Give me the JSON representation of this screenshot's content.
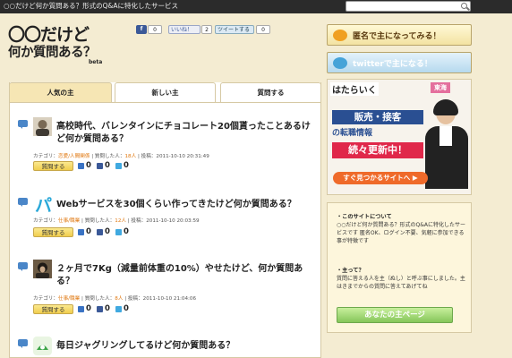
{
  "topbar": {
    "tagline": "○○だけど何か質問ある？形式のQ&Aに特化したサービス",
    "search_placeholder": ""
  },
  "logo": {
    "line1": "〇〇だけど",
    "line2": "何か質問ある？",
    "beta": "beta"
  },
  "social": {
    "facebook_share": "f",
    "facebook_count": "0",
    "like_label": "いいね！",
    "like_count": "2",
    "tweet_label": "ツイートする",
    "tweet_count": "0"
  },
  "tabs": [
    {
      "label": "人気の主"
    },
    {
      "label": "新しい主"
    },
    {
      "label": "質問する"
    }
  ],
  "questions": [
    {
      "title": "高校時代、バレンタインにチョコレート20個貰ったことあるけど何か質問ある？",
      "meta_prefix": "カテゴリ：",
      "category": "恋愛/人間関係",
      "meta_mid": " | 質問した人：",
      "askers": "18人",
      "meta_suffix": " | 投稿：2011-10-10 20:31:49",
      "ask_label": "質問する",
      "counts": [
        "0",
        "0",
        "0"
      ]
    },
    {
      "title": "Webサービスを30個くらい作ってきたけど何か質問ある？",
      "meta_prefix": "カテゴリ：",
      "category": "仕事/職業",
      "meta_mid": " | 質問した人：",
      "askers": "12人",
      "meta_suffix": " | 投稿：2011-10-10 20:03:59",
      "ask_label": "質問する",
      "counts": [
        "0",
        "0",
        "0"
      ]
    },
    {
      "title": "２ヶ月で7Kg（減量前体重の10%）やせたけど、何か質問ある？",
      "meta_prefix": "カテゴリ：",
      "category": "仕事/職業",
      "meta_mid": " | 質問した人：",
      "askers": "8人",
      "meta_suffix": " | 投稿：2011-10-10 21:04:06",
      "ask_label": "質問する",
      "counts": [
        "0",
        "0",
        "0"
      ]
    },
    {
      "title": "毎日ジャグリングしてるけど何か質問ある？"
    }
  ],
  "sidebar": {
    "banner1": "匿名で主になってみる！",
    "banner2": "twitterで主になる！",
    "ad": {
      "brand": "はたらいく",
      "region": "東海",
      "line1": "販売・接客",
      "line2": "の転職情報",
      "line3": "続々更新中！",
      "button": "すぐ見つかるサイトへ ▶"
    },
    "info": {
      "h1": "・このサイトについて",
      "t1": "○○だけど何か質問ある？形式のQ&Aに特化したサービスです 匿名OK、ログイン不要、気軽に参加できる事が特徴です",
      "h2": "・主って？",
      "t2": "質問に答える人を主（ぬし）と呼ぶ事にしました。主はきまでからの質問に答えてあげてね",
      "mypage_button": "あなたの主ページ"
    }
  },
  "colors": {
    "topbar": "#2b2b2b",
    "background": "#f4ecd2",
    "accent_blue": "#4a86c8",
    "ask_button": "#f0cd4e",
    "green_button": "#86c65a"
  }
}
